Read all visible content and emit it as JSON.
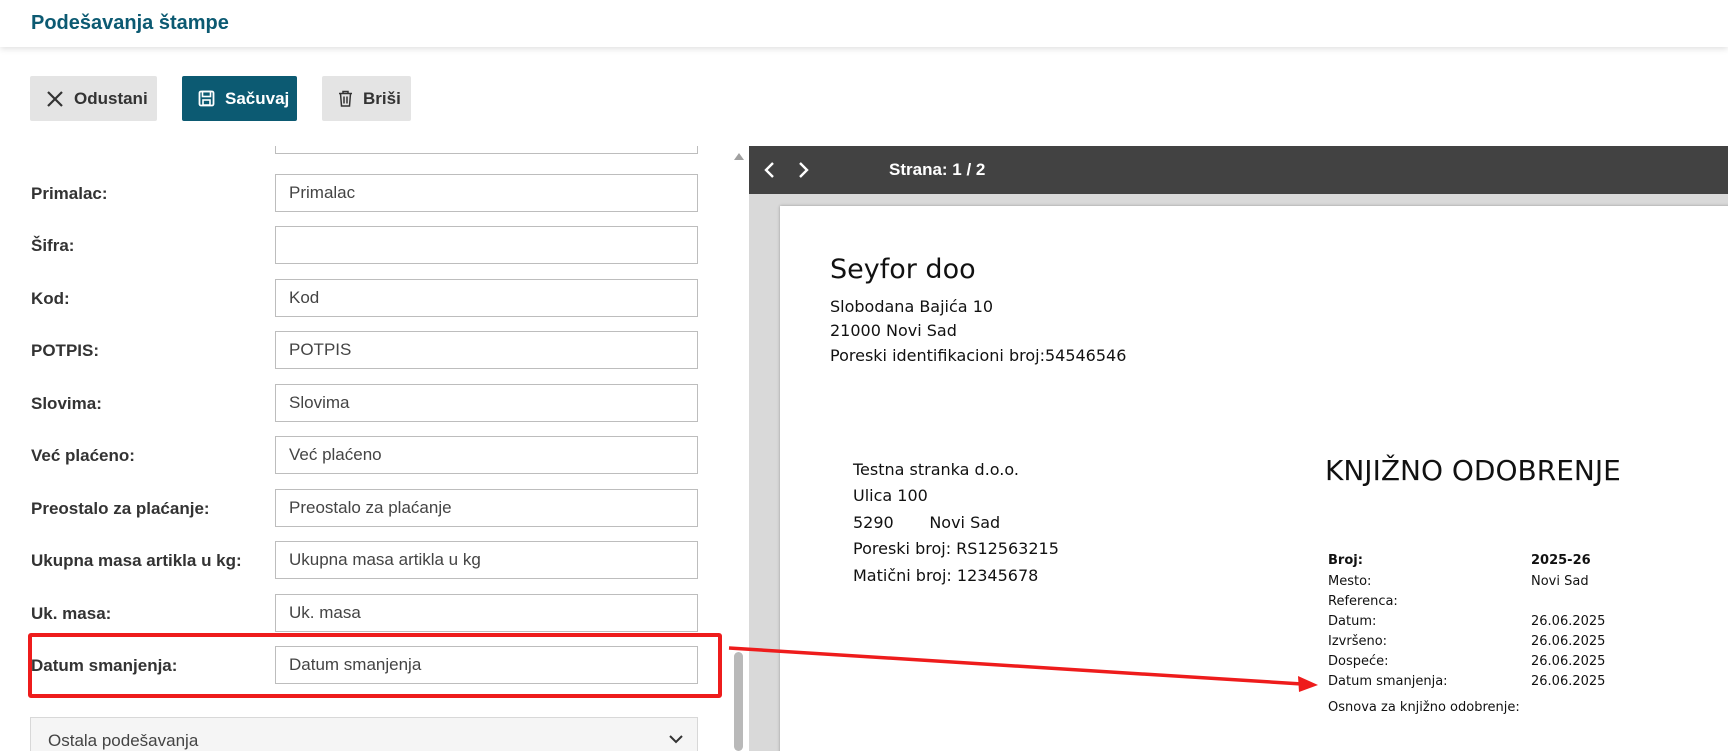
{
  "header": {
    "title": "Podešavanja štampe"
  },
  "toolbar": {
    "cancel_label": "Odustani",
    "save_label": "Sačuvaj",
    "delete_label": "Briši"
  },
  "form": {
    "rows": [
      {
        "label": "Primalac:",
        "value": "Primalac"
      },
      {
        "label": "Šifra:",
        "value": ""
      },
      {
        "label": "Kod:",
        "value": "Kod"
      },
      {
        "label": "POTPIS:",
        "value": "POTPIS"
      },
      {
        "label": "Slovima:",
        "value": "Slovima"
      },
      {
        "label": "Već plaćeno:",
        "value": "Već plaćeno"
      },
      {
        "label": "Preostalo za plaćanje:",
        "value": "Preostalo za plaćanje"
      },
      {
        "label": "Ukupna masa artikla u kg:",
        "value": "Ukupna masa artikla u kg"
      },
      {
        "label": "Uk. masa:",
        "value": "Uk. masa"
      },
      {
        "label": "Datum smanjenja:",
        "value": "Datum smanjenja"
      }
    ],
    "other_settings_label": "Ostala podešavanja"
  },
  "preview": {
    "page_indicator": "Strana: 1 / 2",
    "company": "Seyfor doo",
    "company_lines": [
      "Slobodana Bajića 10",
      "21000 Novi Sad",
      "Poreski identifikacioni broj:54546546"
    ],
    "customer_lines": [
      "Testna stranka d.o.o.",
      "Ulica 100",
      "5290       Novi Sad",
      "Poreski broj: RS12563215",
      "Matični broj: 12345678"
    ],
    "doc_title": "KNJIŽNO ODOBRENJE",
    "meta": [
      {
        "label": "Broj:",
        "value": "2025-26"
      },
      {
        "label": "Mesto:",
        "value": "Novi Sad"
      },
      {
        "label": "Referenca:",
        "value": ""
      },
      {
        "label": "Datum:",
        "value": "26.06.2025"
      },
      {
        "label": "Izvršeno:",
        "value": "26.06.2025"
      },
      {
        "label": "Dospeće:",
        "value": "26.06.2025"
      },
      {
        "label": "Datum smanjenja:",
        "value": "26.06.2025"
      }
    ],
    "basis_label": "Osnova za knjižno odobrenje:"
  },
  "colors": {
    "brand": "#0c5a72",
    "highlight": "#ee1c1c",
    "viewer_bar": "#424242"
  }
}
